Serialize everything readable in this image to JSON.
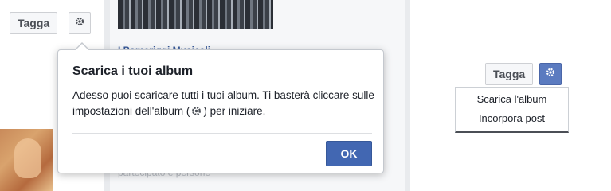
{
  "left_toolbar": {
    "tag_label": "Tagga",
    "gear_icon": "gear-icon"
  },
  "album": {
    "title": "I Pomeriggi Musicali",
    "subtitle": "partecipato e persone"
  },
  "right_toolbar": {
    "tag_label": "Tagga",
    "gear_icon": "gear-icon"
  },
  "menu": {
    "items": [
      "Scarica l'album",
      "Incorpora post"
    ]
  },
  "popover": {
    "title": "Scarica i tuoi album",
    "body_before": "Adesso puoi scaricare tutti i tuoi album. Ti basterà cliccare sulle impostazioni dell'album (",
    "body_icon": "gear-icon",
    "body_after": ") per iniziare.",
    "ok_label": "OK"
  },
  "colors": {
    "accent": "#4267b2",
    "gear_active": "#5b7bc0",
    "link": "#365899"
  }
}
